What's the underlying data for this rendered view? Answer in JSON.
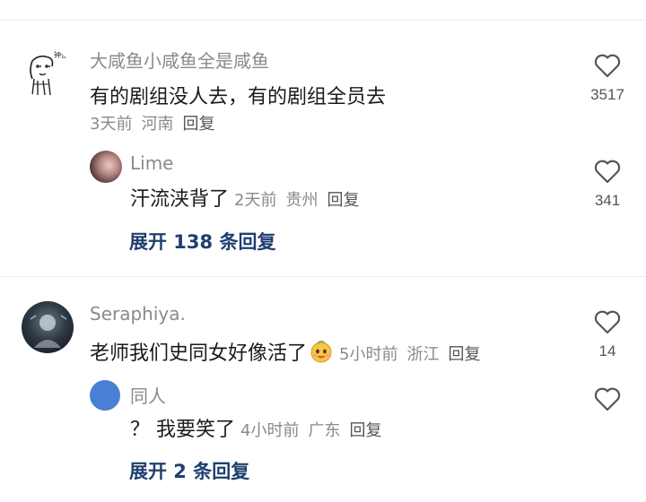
{
  "comments": [
    {
      "username": "大咸鱼小咸鱼全是咸鱼",
      "text": "有的剧组没人去，有的剧组全员去",
      "time": "3天前",
      "location": "河南",
      "reply_label": "回复",
      "likes": "3517",
      "avatar_caption": "钟企",
      "reply": {
        "username": "Lime",
        "text": "汗流浃背了",
        "time": "2天前",
        "location": "贵州",
        "reply_label": "回复",
        "likes": "341"
      },
      "expand_label": "展开 138 条回复"
    },
    {
      "username": "Seraphiya.",
      "text": "老师我们史同女好像活了",
      "time": "5小时前",
      "location": "浙江",
      "reply_label": "回复",
      "likes": "14",
      "emoji": "smiling-face-emoji",
      "reply": {
        "username": "同人",
        "text": "？ 我要笑了",
        "time": "4小时前",
        "location": "广东",
        "reply_label": "回复",
        "likes": ""
      },
      "expand_label": "展开 2 条回复"
    }
  ],
  "colors": {
    "expand_link": "#1f3f6e",
    "avatar_blue": "#4a7fd6",
    "meta_gray": "#8a8a8a",
    "heart_stroke": "#555555"
  },
  "icons": {
    "like": "heart-outline-icon"
  }
}
